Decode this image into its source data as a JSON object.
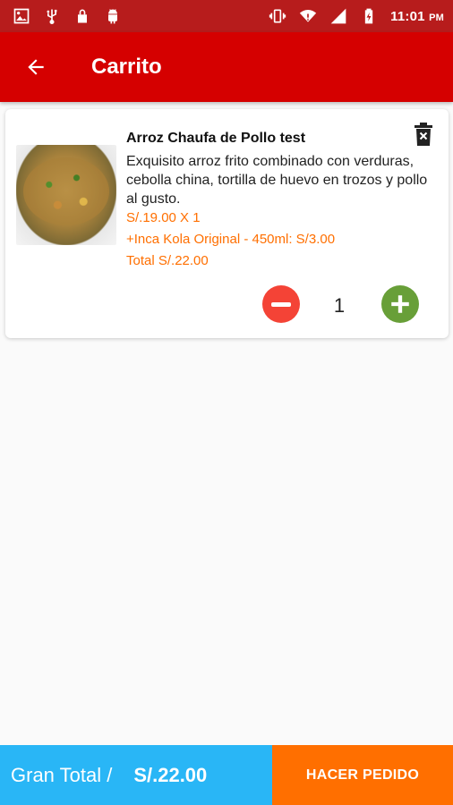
{
  "status_bar": {
    "time": "11:01",
    "meridiem": "PM",
    "left_icons": [
      "image-icon",
      "usb-icon",
      "lock-icon",
      "android-icon"
    ],
    "right_icons": [
      "vibrate-icon",
      "wifi-icon",
      "signal-icon",
      "battery-charging-icon"
    ]
  },
  "toolbar": {
    "title": "Carrito",
    "back_icon": "arrow-back-icon"
  },
  "cart_item": {
    "name": "Arroz Chaufa de Pollo test",
    "description": "Exquisito arroz frito combinado con verduras, cebolla china, tortilla de huevo en trozos y pollo al gusto.",
    "price_line": "S/.19.00 X 1",
    "extra_line": "+Inca Kola Original - 450ml: S/3.00",
    "total_line": "Total S/.22.00",
    "quantity": "1",
    "delete_icon": "delete-icon",
    "minus_icon": "minus-icon",
    "plus_icon": "plus-icon"
  },
  "footer": {
    "grand_total_label": "Gran Total /",
    "grand_total_value": "S/.22.00",
    "order_button": "HACER PEDIDO"
  },
  "colors": {
    "status_bar": "#b71c1c",
    "toolbar": "#d50000",
    "accent_orange": "#ff6f00",
    "grand_total_bg": "#29b6f6",
    "minus_btn": "#f44336",
    "plus_btn": "#689f38"
  }
}
